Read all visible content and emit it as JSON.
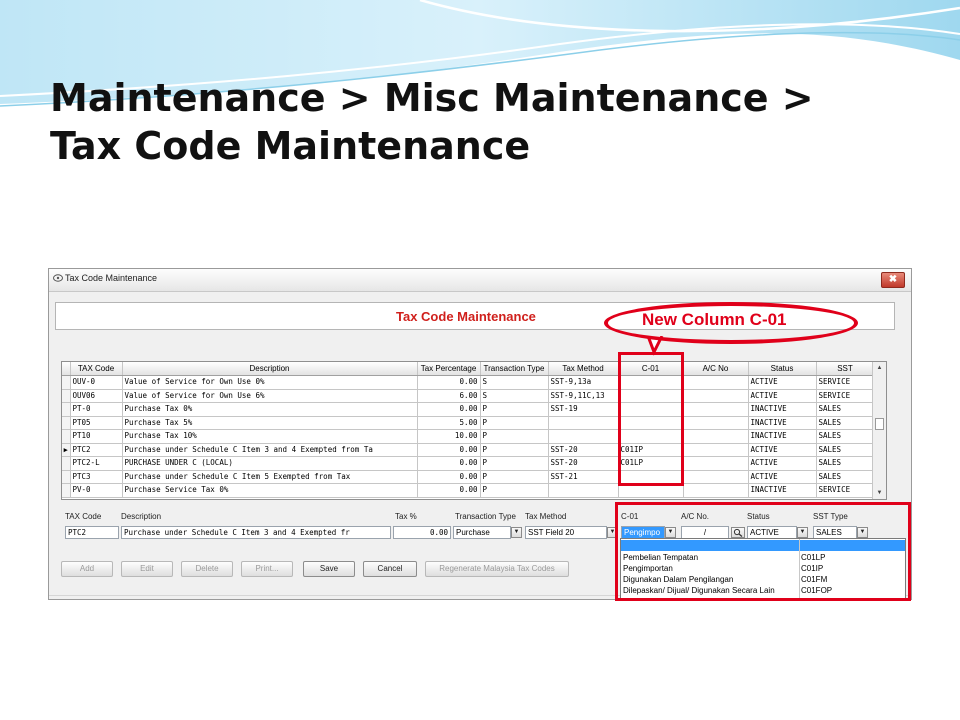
{
  "slide": {
    "title_line1": "Maintenance > Misc Maintenance >",
    "title_line2": "Tax Code Maintenance"
  },
  "window": {
    "title": "Tax Code Maintenance",
    "close_label": "✖",
    "banner_title": "Tax Code Maintenance"
  },
  "annotation": {
    "callout": "New Column C-01",
    "accent_color": "#e0001a"
  },
  "grid": {
    "columns": [
      "TAX Code",
      "Description",
      "Tax Percentage",
      "Transaction Type",
      "Tax Method",
      "C-01",
      "A/C No",
      "Status",
      "SST"
    ],
    "current_row_marker": "▶",
    "rows": [
      {
        "code": "OUV-0",
        "desc": "Value of Service for Own Use 0%",
        "pct": "0.00",
        "type": "S",
        "method": "SST-9,13a",
        "c01": "",
        "acno": "",
        "status": "ACTIVE",
        "sst": "SERVICE"
      },
      {
        "code": "OUV06",
        "desc": "Value of Service for Own Use 6%",
        "pct": "6.00",
        "type": "S",
        "method": "SST-9,11C,13",
        "c01": "",
        "acno": "",
        "status": "ACTIVE",
        "sst": "SERVICE"
      },
      {
        "code": "PT-0",
        "desc": "Purchase Tax 0%",
        "pct": "0.00",
        "type": "P",
        "method": "SST-19",
        "c01": "",
        "acno": "",
        "status": "INACTIVE",
        "sst": "SALES"
      },
      {
        "code": "PT05",
        "desc": "Purchase Tax 5%",
        "pct": "5.00",
        "type": "P",
        "method": "",
        "c01": "",
        "acno": "",
        "status": "INACTIVE",
        "sst": "SALES"
      },
      {
        "code": "PT10",
        "desc": "Purchase Tax 10%",
        "pct": "10.00",
        "type": "P",
        "method": "",
        "c01": "",
        "acno": "",
        "status": "INACTIVE",
        "sst": "SALES"
      },
      {
        "code": "PTC2",
        "desc": "Purchase under Schedule C Item 3 and 4 Exempted from Ta",
        "pct": "0.00",
        "type": "P",
        "method": "SST-20",
        "c01": "C01IP",
        "acno": "",
        "status": "ACTIVE",
        "sst": "SALES"
      },
      {
        "code": "PTC2-L",
        "desc": "PURCHASE UNDER C (LOCAL)",
        "pct": "0.00",
        "type": "P",
        "method": "SST-20",
        "c01": "C01LP",
        "acno": "",
        "status": "ACTIVE",
        "sst": "SALES"
      },
      {
        "code": "PTC3",
        "desc": "Purchase under Schedule C Item 5 Exempted from Tax",
        "pct": "0.00",
        "type": "P",
        "method": "SST-21",
        "c01": "",
        "acno": "",
        "status": "ACTIVE",
        "sst": "SALES"
      },
      {
        "code": "PV-0",
        "desc": "Purchase Service Tax 0%",
        "pct": "0.00",
        "type": "P",
        "method": "",
        "c01": "",
        "acno": "",
        "status": "INACTIVE",
        "sst": "SERVICE"
      }
    ]
  },
  "edit": {
    "labels": {
      "code": "TAX Code",
      "desc": "Description",
      "pct": "Tax %",
      "type": "Transaction Type",
      "method": "Tax Method",
      "c01": "C-01",
      "acno": "A/C No.",
      "status": "Status",
      "sst": "SST Type"
    },
    "values": {
      "code": "PTC2",
      "desc": "Purchase under Schedule C Item 3 and 4 Exempted fr",
      "pct": "0.00",
      "type": "Purchase",
      "method": "SST Field 20",
      "c01": "Pengimpo",
      "acno": "/",
      "status": "ACTIVE",
      "sst": "SALES"
    }
  },
  "buttons": {
    "add": "Add",
    "edit": "Edit",
    "delete": "Delete",
    "print": "Print...",
    "save": "Save",
    "cancel": "Cancel",
    "regen": "Regenerate Malaysia Tax Codes"
  },
  "dropdown": {
    "options": [
      {
        "name": "",
        "code": ""
      },
      {
        "name": "Pembelian Tempatan",
        "code": "C01LP"
      },
      {
        "name": "Pengimportan",
        "code": "C01IP"
      },
      {
        "name": "Digunakan Dalam Pengilangan",
        "code": "C01FM"
      },
      {
        "name": "Dilepaskan/ Dijual/ Digunakan Secara Lain",
        "code": "C01FOP"
      }
    ]
  }
}
